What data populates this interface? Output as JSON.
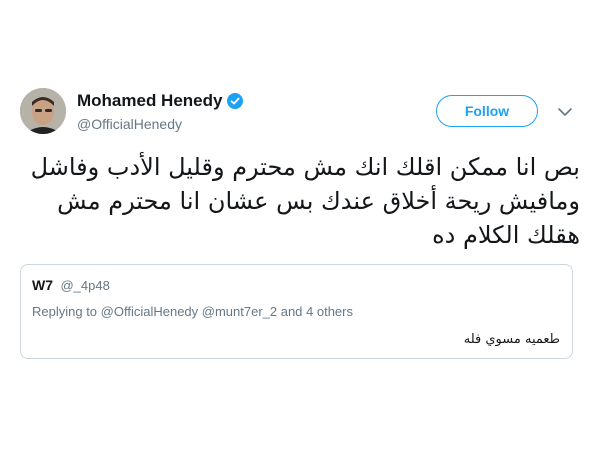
{
  "author": {
    "name": "Mohamed Henedy",
    "handle": "@OfficialHenedy",
    "verified": true
  },
  "follow_label": "Follow",
  "tweet": {
    "text": "بص انا ممكن اقلك انك مش محترم وقليل الأدب وفاشل ومافيش ريحة أخلاق عندك بس عشان انا محترم مش هقلك الكلام ده"
  },
  "quoted_tweet": {
    "name": "W7",
    "handle": "@_4p48",
    "replying_to": "Replying to @OfficialHenedy @munt7er_2 and 4 others",
    "text": "طعميه مسوي فله"
  },
  "colors": {
    "accent": "#1da1f2",
    "secondary_text": "#657786",
    "border": "#ccd6dd"
  }
}
